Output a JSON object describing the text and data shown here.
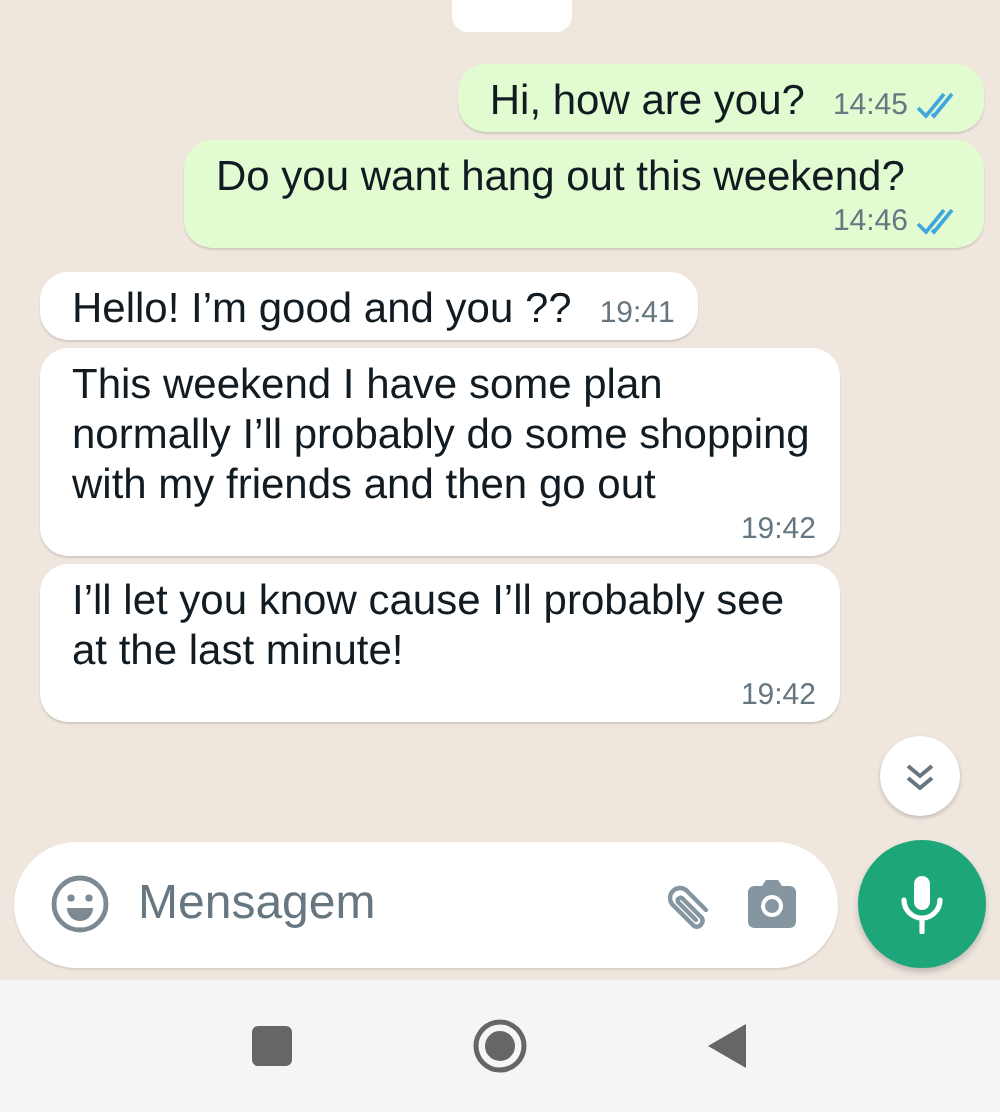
{
  "messages": [
    {
      "kind": "outgoing",
      "text": "Hi, how are you?",
      "time": "14:45",
      "read": true
    },
    {
      "kind": "outgoing",
      "text": "Do you want hang out this weekend?",
      "time": "14:46",
      "read": true
    },
    {
      "kind": "incoming",
      "text": "Hello! I’m good and you ??",
      "time": "19:41"
    },
    {
      "kind": "incoming",
      "text": "This weekend I have some plan normally I’ll probably do some shopping with my friends and then go out",
      "time": "19:42"
    },
    {
      "kind": "incoming",
      "text": "I’ll let you know cause I’ll probably see at the last minute!",
      "time": "19:42"
    }
  ],
  "composer": {
    "placeholder": "Mensagem"
  }
}
